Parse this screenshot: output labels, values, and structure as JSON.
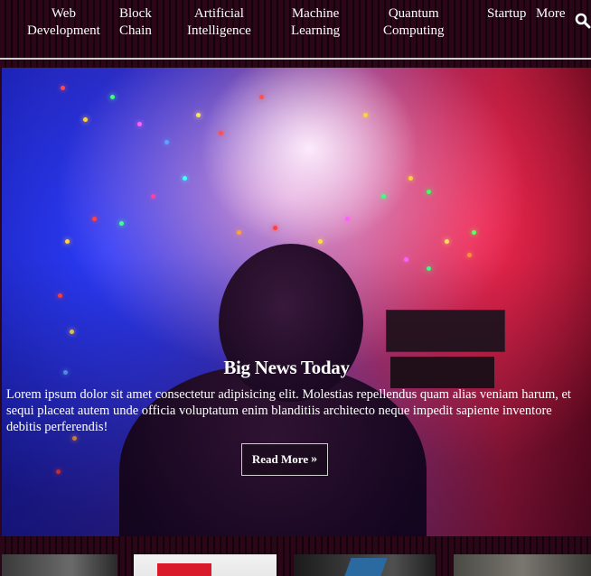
{
  "nav": {
    "items": [
      {
        "line1": "Web",
        "line2": "Development"
      },
      {
        "line1": "Block",
        "line2": "Chain"
      },
      {
        "line1": "Artificial",
        "line2": "Intelligence"
      },
      {
        "line1": "Machine",
        "line2": "Learning"
      },
      {
        "line1": "Quantum",
        "line2": "Computing"
      },
      {
        "line1": "Startup",
        "line2": ""
      },
      {
        "line1": "More",
        "line2": ""
      }
    ],
    "search_icon": "search-icon"
  },
  "hero": {
    "title": "Big News Today",
    "text": "Lorem ipsum dolor sit amet consectetur adipisicing elit. Molestias repellendus quam alias veniam harum, et sequi placeat autem unde officia voluptatum enim blanditiis architecto neque impedit sapiente inventore debitis perferendis!",
    "button_label": "Read More",
    "button_icon": "double-chevron-right-icon"
  },
  "colors": {
    "background": "#2a0618",
    "text": "#ffffff",
    "nav_divider": "#cfcfcf"
  }
}
